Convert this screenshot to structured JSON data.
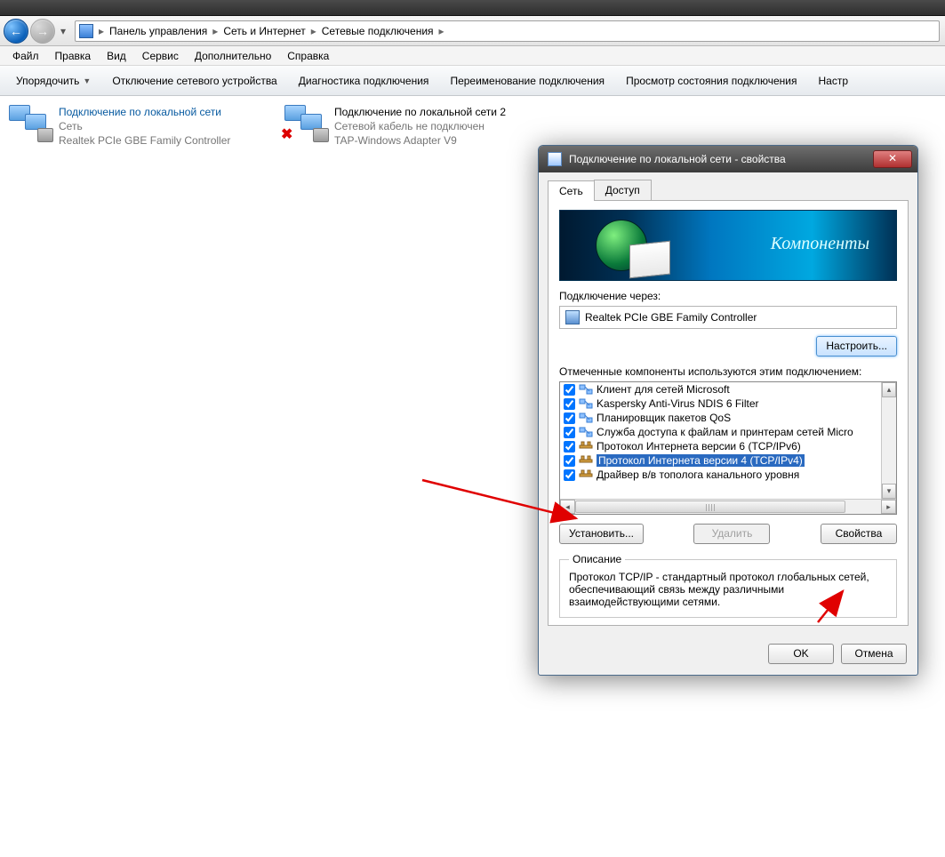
{
  "breadcrumb": {
    "items": [
      "Панель управления",
      "Сеть и Интернет",
      "Сетевые подключения"
    ]
  },
  "menu": {
    "file": "Файл",
    "edit": "Правка",
    "view": "Вид",
    "tools": "Сервис",
    "advanced": "Дополнительно",
    "help": "Справка"
  },
  "toolbar": {
    "organize": "Упорядочить",
    "disable": "Отключение сетевого устройства",
    "diagnose": "Диагностика подключения",
    "rename": "Переименование подключения",
    "status": "Просмотр состояния подключения",
    "settings": "Настр"
  },
  "connections": [
    {
      "title": "Подключение по локальной сети",
      "line1": "Сеть",
      "line2": "Realtek PCIe GBE Family Controller",
      "error": false
    },
    {
      "title": "Подключение по локальной сети 2",
      "line1": "Сетевой кабель не подключен",
      "line2": "TAP-Windows Adapter V9",
      "error": true
    }
  ],
  "dialog": {
    "title": "Подключение по локальной сети - свойства",
    "tabs": {
      "net": "Сеть",
      "access": "Доступ"
    },
    "banner": "Компоненты",
    "connect_via_label": "Подключение через:",
    "adapter": "Realtek PCIe GBE Family Controller",
    "configure": "Настроить...",
    "components_label": "Отмеченные компоненты используются этим подключением:",
    "components": [
      {
        "checked": true,
        "label": "Клиент для сетей Microsoft",
        "kind": "net"
      },
      {
        "checked": true,
        "label": "Kaspersky Anti-Virus NDIS 6 Filter",
        "kind": "net"
      },
      {
        "checked": true,
        "label": "Планировщик пакетов QoS",
        "kind": "net"
      },
      {
        "checked": true,
        "label": "Служба доступа к файлам и принтерам сетей Micro",
        "kind": "net"
      },
      {
        "checked": true,
        "label": "Протокол Интернета версии 6 (TCP/IPv6)",
        "kind": "proto"
      },
      {
        "checked": true,
        "label": "Протокол Интернета версии 4 (TCP/IPv4)",
        "kind": "proto",
        "selected": true
      },
      {
        "checked": true,
        "label": "Драйвер в/в тополога канального уровня",
        "kind": "proto"
      }
    ],
    "install": "Установить...",
    "remove": "Удалить",
    "properties": "Свойства",
    "desc_legend": "Описание",
    "description": "Протокол TCP/IP - стандартный протокол глобальных сетей, обеспечивающий связь между различными взаимодействующими сетями.",
    "ok": "OK",
    "cancel": "Отмена"
  }
}
